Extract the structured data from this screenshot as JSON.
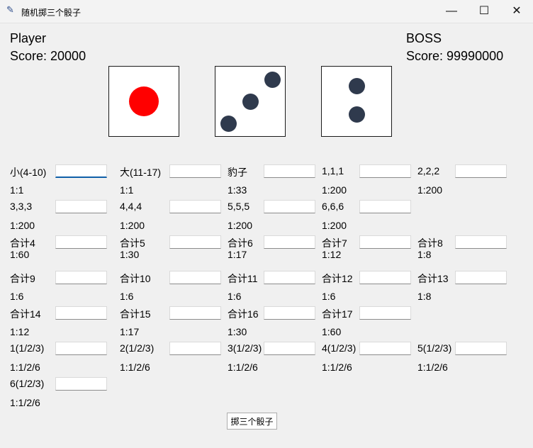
{
  "window": {
    "title": "随机掷三个骰子",
    "feather_icon": "feather-icon",
    "minimize_glyph": "—",
    "maximize_glyph": "☐",
    "close_glyph": "✕"
  },
  "player": {
    "name": "Player",
    "score": "Score: 20000"
  },
  "boss": {
    "name": "BOSS",
    "score": "Score: 99990000"
  },
  "dice": [
    {
      "value": 1,
      "pip_color": "#ff0000"
    },
    {
      "value": 3,
      "pip_color": "#2f3a4d"
    },
    {
      "value": 2,
      "pip_color": "#2f3a4d"
    }
  ],
  "bets": [
    {
      "label": "小(4-10)",
      "odds": "1:1",
      "value": ""
    },
    {
      "label": "大(11-17)",
      "odds": "1:1",
      "value": ""
    },
    {
      "label": "豹子",
      "odds": "1:33",
      "value": ""
    },
    {
      "label": "1,1,1",
      "odds": "1:200",
      "value": ""
    },
    {
      "label": "2,2,2",
      "odds": "1:200",
      "value": ""
    },
    {
      "label": "3,3,3",
      "odds": "1:200",
      "value": ""
    },
    {
      "label": "4,4,4",
      "odds": "1:200",
      "value": ""
    },
    {
      "label": "5,5,5",
      "odds": "1:200",
      "value": ""
    },
    {
      "label": "6,6,6",
      "odds": "1:200",
      "value": ""
    },
    {
      "label": "合计4",
      "odds": "1:60",
      "value": ""
    },
    {
      "label": "合计5",
      "odds": "1:30",
      "value": ""
    },
    {
      "label": "合计6",
      "odds": "1:17",
      "value": ""
    },
    {
      "label": "合计7",
      "odds": "1:12",
      "value": ""
    },
    {
      "label": "合计8",
      "odds": "1:8",
      "value": ""
    },
    {
      "label": "合计9",
      "odds": "1:6",
      "value": ""
    },
    {
      "label": "合计10",
      "odds": "1:6",
      "value": ""
    },
    {
      "label": "合计11",
      "odds": "1:6",
      "value": ""
    },
    {
      "label": "合计12",
      "odds": "1:6",
      "value": ""
    },
    {
      "label": "合计13",
      "odds": "1:8",
      "value": ""
    },
    {
      "label": "合计14",
      "odds": "1:12",
      "value": ""
    },
    {
      "label": "合计15",
      "odds": "1:17",
      "value": ""
    },
    {
      "label": "合计16",
      "odds": "1:30",
      "value": ""
    },
    {
      "label": "合计17",
      "odds": "1:60",
      "value": ""
    },
    {
      "label": "1(1/2/3)",
      "odds": "1:1/2/6",
      "value": ""
    },
    {
      "label": "2(1/2/3)",
      "odds": "1:1/2/6",
      "value": ""
    },
    {
      "label": "3(1/2/3)",
      "odds": "1:1/2/6",
      "value": ""
    },
    {
      "label": "4(1/2/3)",
      "odds": "1:1/2/6",
      "value": ""
    },
    {
      "label": "5(1/2/3)",
      "odds": "1:1/2/6",
      "value": ""
    },
    {
      "label": "6(1/2/3)",
      "odds": "1:1/2/6",
      "value": ""
    }
  ],
  "roll_button": "掷三个骰子"
}
